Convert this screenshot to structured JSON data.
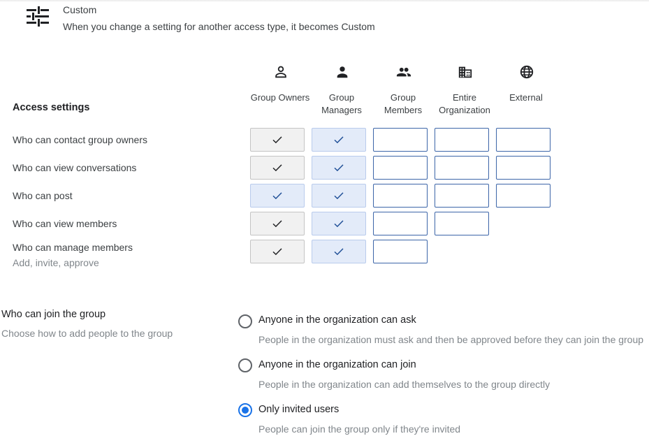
{
  "custom": {
    "title": "Custom",
    "description": "When you change a setting for another access type, it becomes Custom",
    "icon": "tune-sliders-icon"
  },
  "columns": [
    {
      "label": "Group Owners",
      "icon": "person-outline-icon"
    },
    {
      "label": "Group Managers",
      "icon": "person-filled-icon"
    },
    {
      "label": "Group Members",
      "icon": "people-icon"
    },
    {
      "label": "Entire Organization",
      "icon": "building-icon"
    },
    {
      "label": "External",
      "icon": "globe-icon"
    }
  ],
  "access": {
    "heading": "Access settings",
    "rows": [
      {
        "label": "Who can contact group owners",
        "sublabel": "",
        "cells": [
          "checked-gray",
          "checked-blue",
          "empty",
          "empty",
          "empty"
        ]
      },
      {
        "label": "Who can view conversations",
        "sublabel": "",
        "cells": [
          "checked-gray",
          "checked-blue",
          "empty",
          "empty",
          "empty"
        ]
      },
      {
        "label": "Who can post",
        "sublabel": "",
        "cells": [
          "checked-blue",
          "checked-blue",
          "empty",
          "empty",
          "empty"
        ]
      },
      {
        "label": "Who can view members",
        "sublabel": "",
        "cells": [
          "checked-gray",
          "checked-blue",
          "empty",
          "empty",
          "none"
        ]
      },
      {
        "label": "Who can manage members",
        "sublabel": "Add, invite, approve",
        "cells": [
          "checked-gray",
          "checked-blue",
          "empty",
          "none",
          "none"
        ]
      }
    ]
  },
  "join": {
    "title": "Who can join the group",
    "subtitle": "Choose how to add people to the group",
    "options": [
      {
        "label": "Anyone in the organization can ask",
        "description": "People in the organization must ask and then be approved before they can join the group",
        "selected": false
      },
      {
        "label": "Anyone in the organization can join",
        "description": "People in the organization can add themselves to the group directly",
        "selected": false
      },
      {
        "label": "Only invited users",
        "description": "People can join the group only if they're invited",
        "selected": true
      }
    ]
  },
  "colors": {
    "check_dark": "#202124",
    "check_blue": "#1f4f97",
    "radio_selected": "#1a73e8"
  }
}
